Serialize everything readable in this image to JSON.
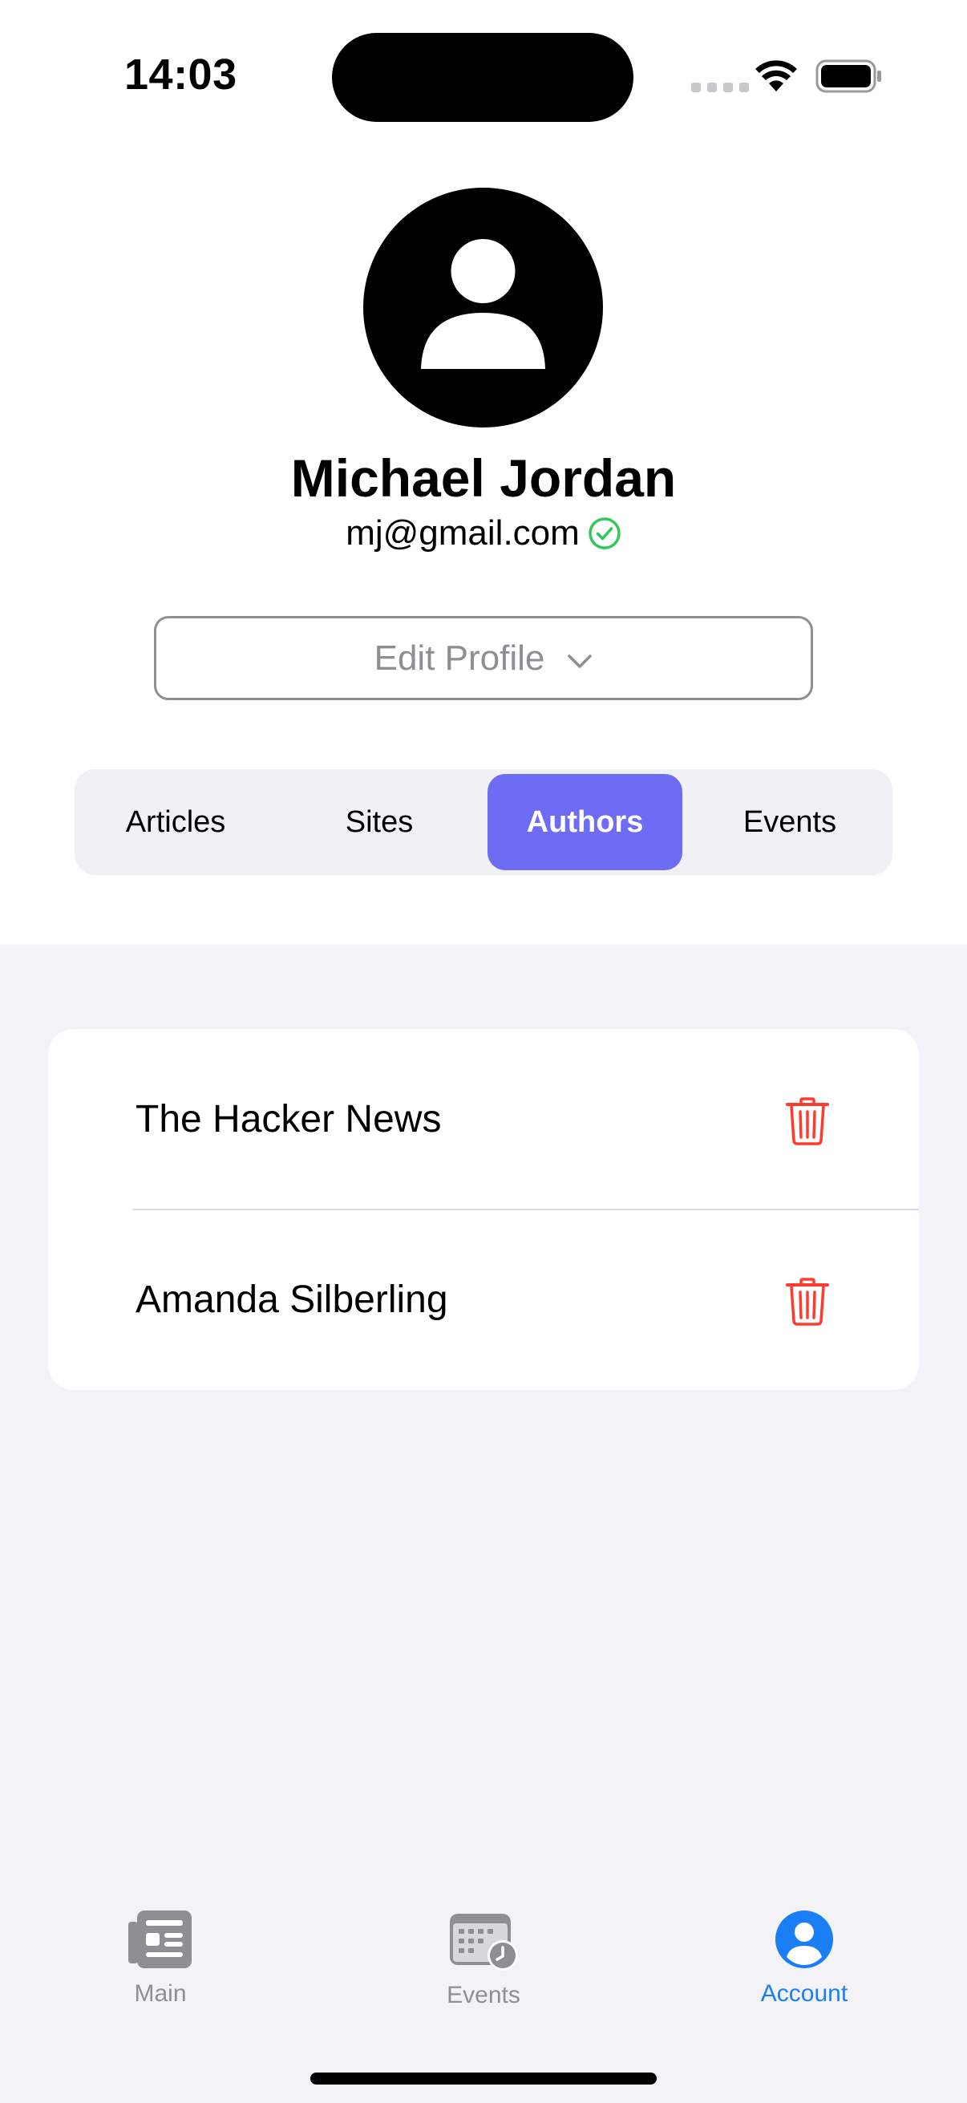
{
  "status_bar": {
    "time": "14:03"
  },
  "profile": {
    "name": "Michael Jordan",
    "email": "mj@gmail.com",
    "verified": true,
    "edit_button_label": "Edit Profile"
  },
  "segments": {
    "items": [
      "Articles",
      "Sites",
      "Authors",
      "Events"
    ],
    "selected": "Authors"
  },
  "authors": [
    {
      "name": "The Hacker News"
    },
    {
      "name": "Amanda Silberling"
    }
  ],
  "tab_bar": {
    "items": [
      {
        "label": "Main",
        "icon": "newspaper-icon"
      },
      {
        "label": "Events",
        "icon": "calendar-clock-icon"
      },
      {
        "label": "Account",
        "icon": "person-circle-icon"
      }
    ],
    "selected": "Account"
  },
  "colors": {
    "accent": "#6e6bf5",
    "tab_active": "#1a7ff5",
    "delete": "#ff3b30",
    "verified": "#34c759",
    "background": "#f2f2f7"
  }
}
